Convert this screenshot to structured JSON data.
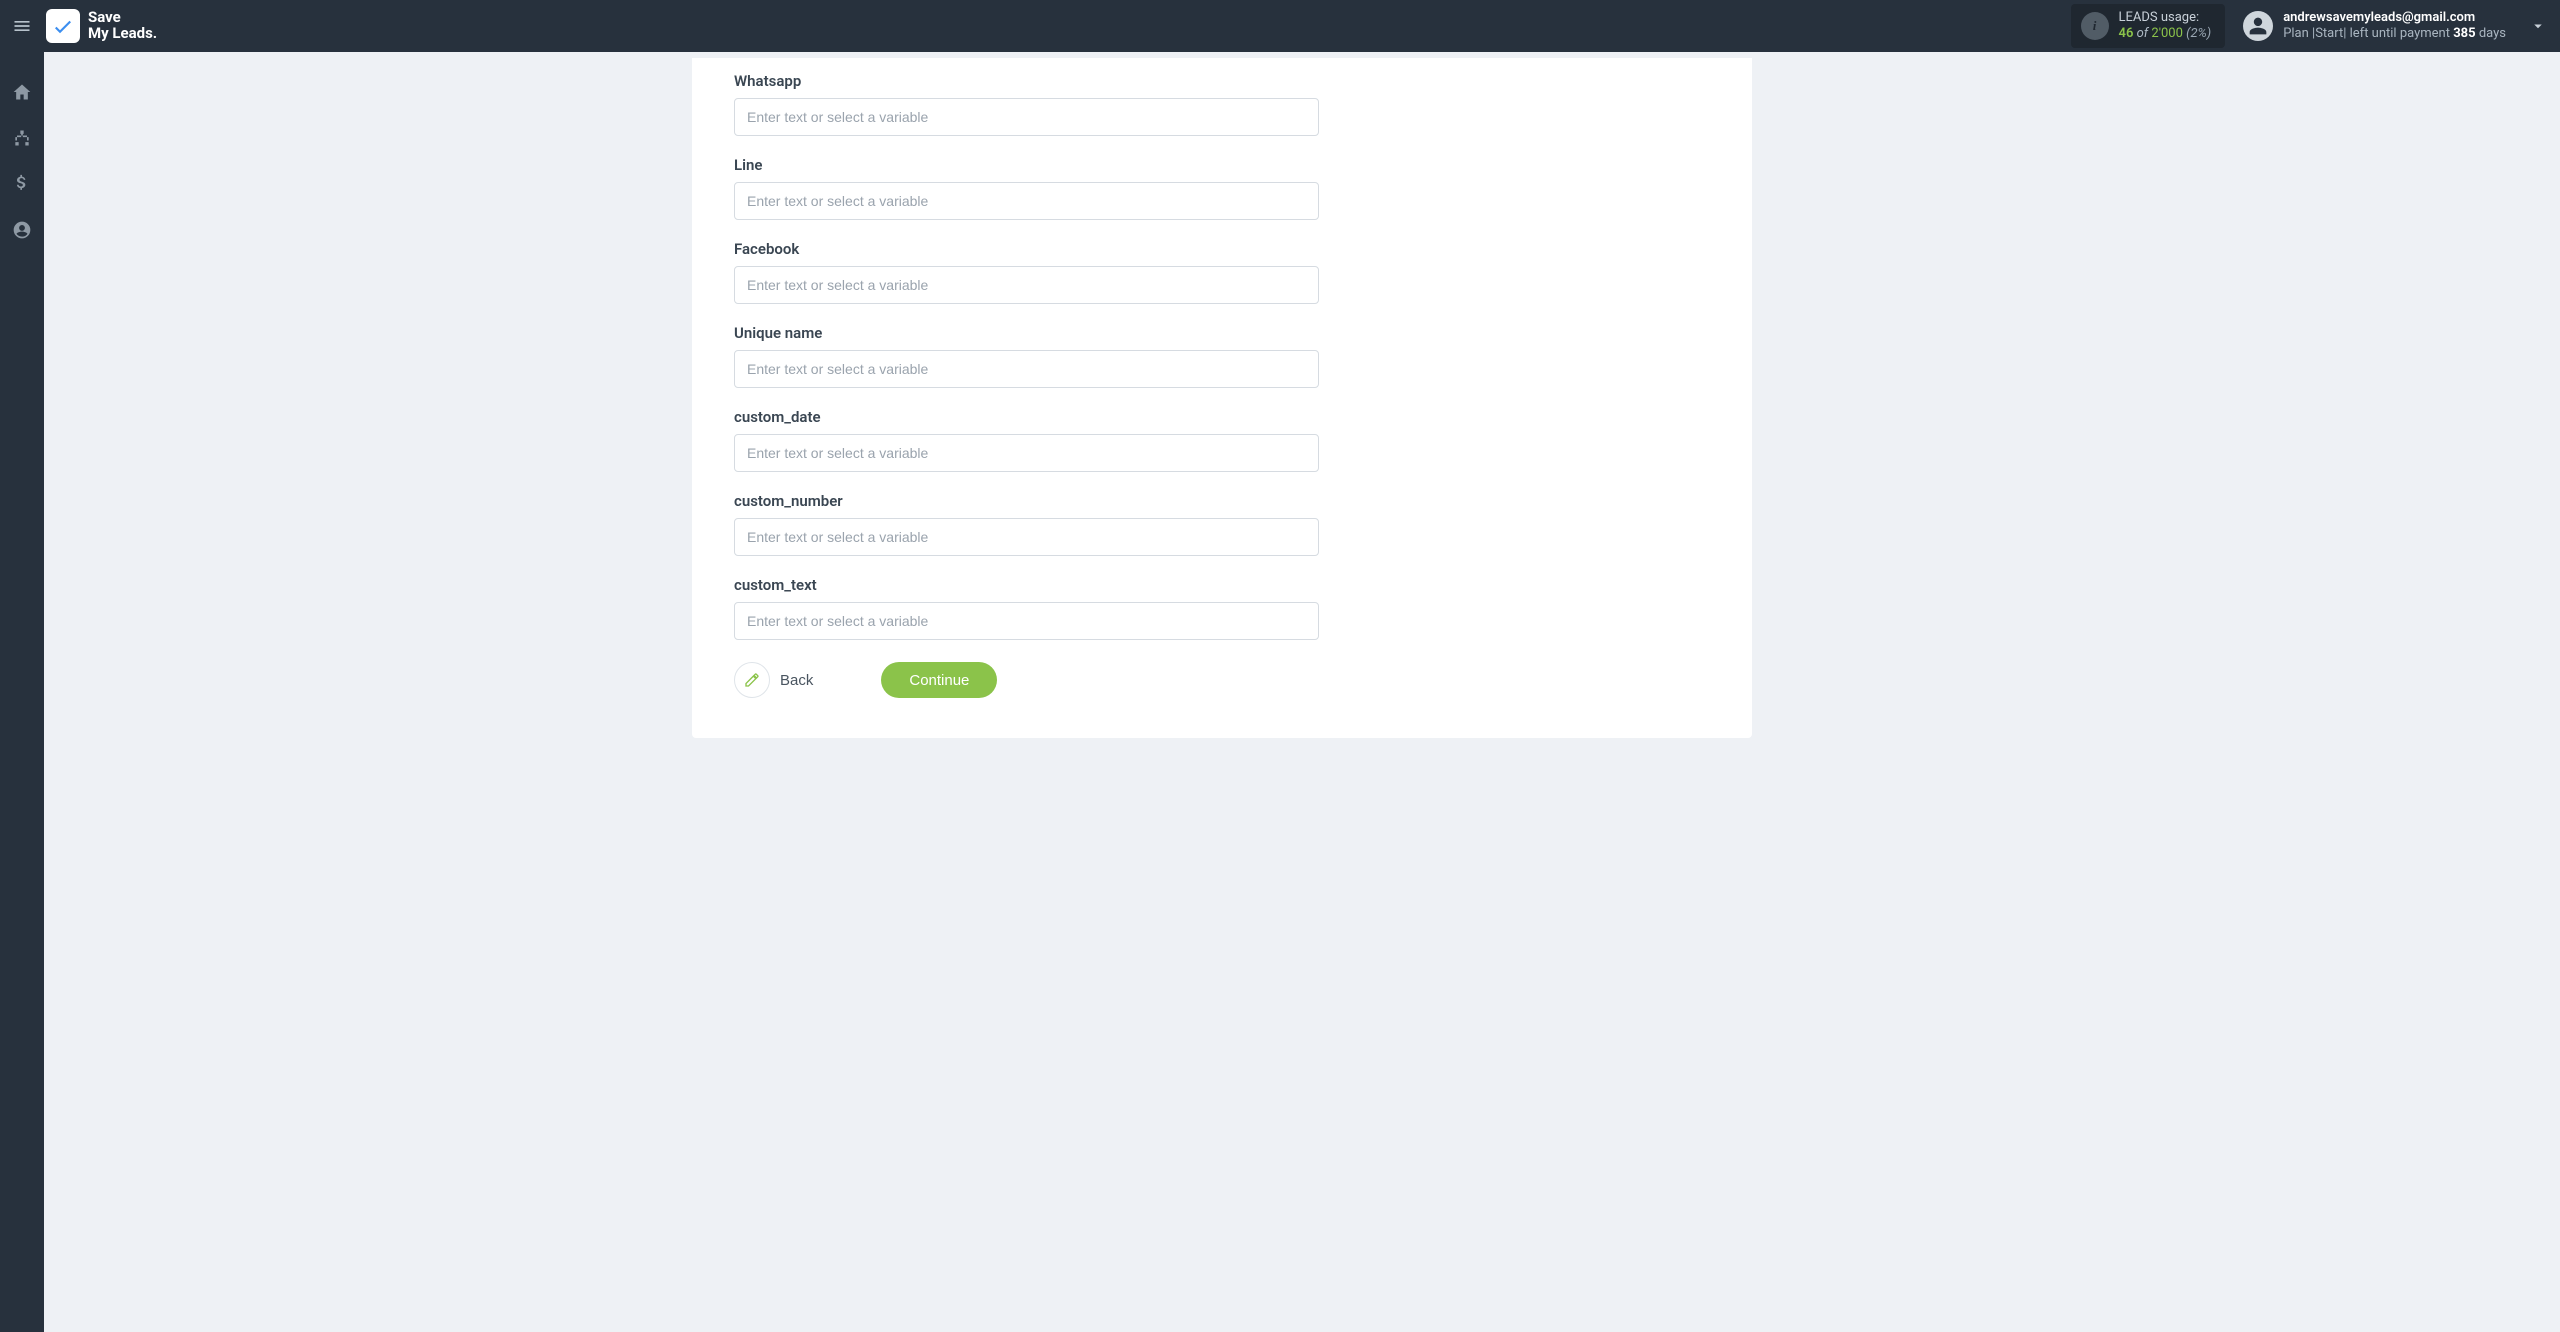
{
  "brand": {
    "line1": "Save",
    "line2": "My Leads."
  },
  "usage": {
    "label": "LEADS usage:",
    "current": "46",
    "of": "of",
    "limit": "2'000",
    "pct": "(2%)"
  },
  "account": {
    "email": "andrewsavemyleads@gmail.com",
    "plan_prefix": "Plan |Start| left until payment ",
    "days_num": "385",
    "days_suffix": " days"
  },
  "form": {
    "placeholder": "Enter text or select a variable",
    "fields": [
      {
        "label": "Whatsapp"
      },
      {
        "label": "Line"
      },
      {
        "label": "Facebook"
      },
      {
        "label": "Unique name"
      },
      {
        "label": "custom_date"
      },
      {
        "label": "custom_number"
      },
      {
        "label": "custom_text"
      }
    ],
    "back_label": "Back",
    "continue_label": "Continue"
  }
}
